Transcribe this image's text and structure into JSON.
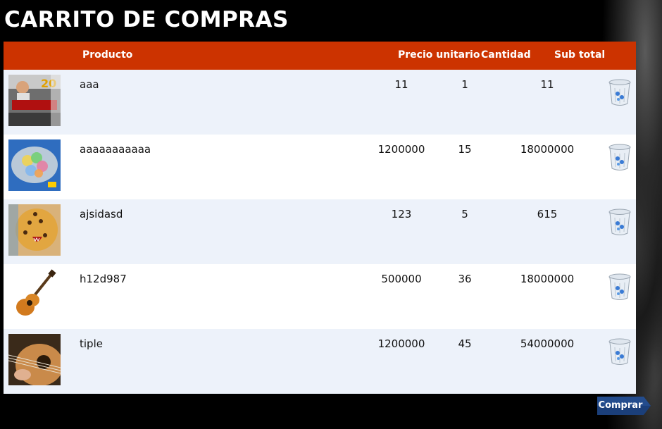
{
  "page": {
    "title": "CARRITO DE COMPRAS"
  },
  "table": {
    "headers": {
      "product": "Producto",
      "unit_price": "Precio unitario",
      "quantity": "Cantidad",
      "subtotal": "Sub total"
    },
    "rows": [
      {
        "name": "aaa",
        "price": "11",
        "qty": "1",
        "subtotal": "11",
        "image": "home-depot-car-thumbnail"
      },
      {
        "name": "aaaaaaaaaaa",
        "price": "1200000",
        "qty": "15",
        "subtotal": "18000000",
        "image": "colorful-spheres-thumbnail"
      },
      {
        "name": "ajsidasd",
        "price": "123",
        "qty": "5",
        "subtotal": "615",
        "image": "jaguar-mask-thumbnail"
      },
      {
        "name": "h12d987",
        "price": "500000",
        "qty": "36",
        "subtotal": "18000000",
        "image": "acoustic-guitar-thumbnail"
      },
      {
        "name": "tiple",
        "price": "1200000",
        "qty": "45",
        "subtotal": "54000000",
        "image": "guitar-closeup-thumbnail"
      }
    ]
  },
  "actions": {
    "buy_label": "Comprar",
    "delete_icon": "trash-icon"
  },
  "colors": {
    "header_bar": "#cc3300",
    "row_alt": "#edf2fa",
    "button": "#1b3f7a"
  }
}
